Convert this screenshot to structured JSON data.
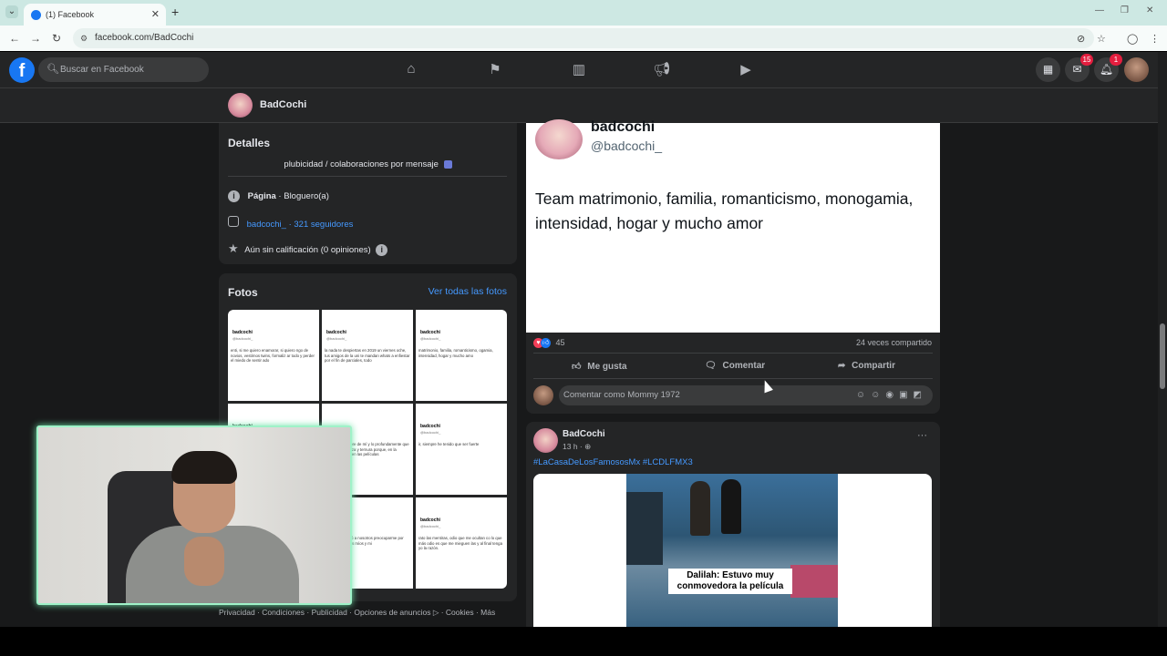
{
  "browser": {
    "tab_title": "(1) Facebook",
    "url": "facebook.com/BadCochi",
    "new_tab": "+",
    "tab_close": "✕"
  },
  "fb": {
    "logo": "f",
    "search_placeholder": "Buscar en Facebook",
    "messenger_badge": "15",
    "notifications_badge": "1"
  },
  "page": {
    "name": "BadCochi",
    "more": "···"
  },
  "details": {
    "title": "Detalles",
    "bio": "plubicidad / colaboraciones por mensaje",
    "category_label": "Página",
    "category_value": " · Bloguero(a)",
    "instagram": "badcochi_ · 321 seguidores",
    "rating": "Aún sin calificación (0 opiniones)"
  },
  "photos": {
    "title": "Fotos",
    "see_all": "Ver todas las fotos",
    "cells": [
      {
        "name": "badcochi",
        "handle": "@badcochi_",
        "text": "enti, si me quiero enamorar, si quiero ngo de novios, vestirnos twins, formaliz ar todo y perder el miedo de sentir ado"
      },
      {
        "name": "badcochi",
        "handle": "@badcochi_",
        "text": "la nada te despiertas en 2019 un viernes oche, tus amigos de la uni te mandan whats a enfiestar por el fin de parciales, todo"
      },
      {
        "name": "badcochi",
        "handle": "@badcochi_",
        "text": "matrimonio, familia, romanticismo, ogamia, intensidad, hogar y mucho amo"
      },
      {
        "name": "badcochi",
        "handle": "",
        "text": ""
      },
      {
        "name": "",
        "handle": "",
        "text": "quien se enamore de mí y lo profundamente que me traten con eza y ternura porque, en la mayoría de mo en las películas"
      },
      {
        "name": "badcochi",
        "handle": "@badcochi_",
        "text": "ir, siempre he tenido que ser fuerte"
      },
      {
        "name": "",
        "handle": "",
        "text": ""
      },
      {
        "name": "",
        "handle": "",
        "text": "o y la vida volvió a nosotros preocuparme por mis d mental, los míos y mi"
      },
      {
        "name": "badcochi",
        "handle": "@badcochi_",
        "text": "rato las mentiras, odio que me ocultan co lo que más odio es que me mieguen las y al final tenga yo la razón."
      }
    ]
  },
  "footer": "Privacidad · Condiciones · Publicidad · Opciones de anuncios ▷ · Cookies · Más",
  "post1": {
    "tweet_name": "badcochi",
    "tweet_handle": "@badcochi_",
    "tweet_text": "Team matrimonio, familia, romanticismo, monogamia, intensidad, hogar y mucho amor",
    "reaction_count": "45",
    "shares": "24 veces compartido",
    "like": "Me gusta",
    "comment": "Comentar",
    "share": "Compartir",
    "comment_placeholder": "Comentar como Mommy 1972"
  },
  "post2": {
    "author": "BadCochi",
    "time": "13 h · ",
    "more": "···",
    "hashtags": "#LaCasaDeLosFamososMx #LCDLFMX3",
    "caption": "Dalilah: Estuvo muy conmovedora la película"
  },
  "colors": {
    "fb_blue": "#1877f2",
    "link_blue": "#4599ff",
    "dark_bg": "#18191a",
    "card_bg": "#242526",
    "webcam_border": "#9ff2c8"
  }
}
